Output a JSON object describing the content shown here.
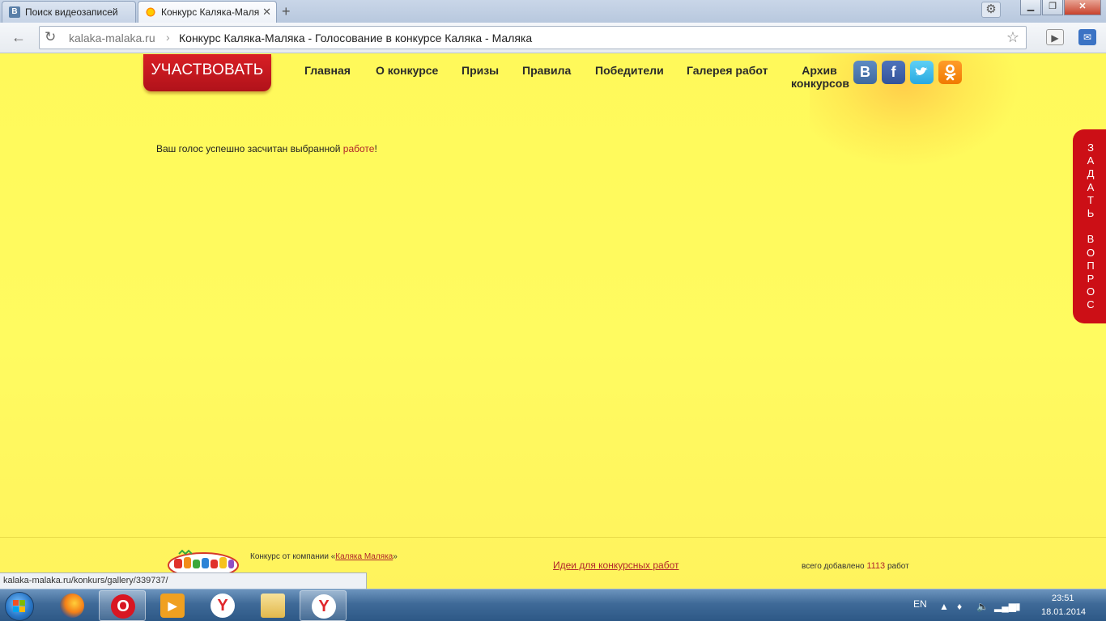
{
  "browser": {
    "tabs": [
      {
        "label": "Поиск видеозаписей",
        "favicon": "vk-icon",
        "active": false
      },
      {
        "label": "Конкурс Каляка-Маля",
        "favicon": "sun-icon",
        "active": true
      }
    ],
    "omnibox": {
      "domain": "kalaka-malaka.ru",
      "separator": "›",
      "title": "Конкурс Каляка-Маляка - Голосование в конкурсе Каляка - Маляка"
    }
  },
  "site": {
    "participate_label": "УЧАСТВОВАТЬ",
    "menu": [
      {
        "label": "Главная"
      },
      {
        "label": "О конкурсе"
      },
      {
        "label": "Призы"
      },
      {
        "label": "Правила"
      },
      {
        "label": "Победители"
      },
      {
        "label": "Галерея работ"
      },
      {
        "label": "Архив конкурсов",
        "line1": "Архив",
        "line2": "конкурсов"
      }
    ],
    "social": [
      {
        "name": "vkontakte-icon",
        "glyph": "B"
      },
      {
        "name": "facebook-icon",
        "glyph": "f"
      },
      {
        "name": "twitter-icon",
        "glyph": "t"
      },
      {
        "name": "odnoklassniki-icon",
        "glyph": "ок"
      }
    ],
    "message": {
      "before": "Ваш голос успешно засчитан выбранной ",
      "link": "работе",
      "after": "!"
    },
    "ask_question": "ЗАДАТЬ ВОПРОС",
    "footer": {
      "company_prefix": "Конкурс от компании «",
      "company_link": "Каляка Маляка",
      "company_suffix": "»",
      "ideas_link": "Идеи для конкурсных работ",
      "count_prefix": "всего добавлено ",
      "count_value": "1113",
      "count_suffix": " работ"
    }
  },
  "status_url": "kalaka-malaka.ru/konkurs/gallery/339737/",
  "taskbar": {
    "language": "EN",
    "time": "23:51",
    "date": "18.01.2014"
  },
  "colors": {
    "page_background": "#fffb5c",
    "accent_red": "#cc0f16",
    "link_red": "#b1262b"
  }
}
